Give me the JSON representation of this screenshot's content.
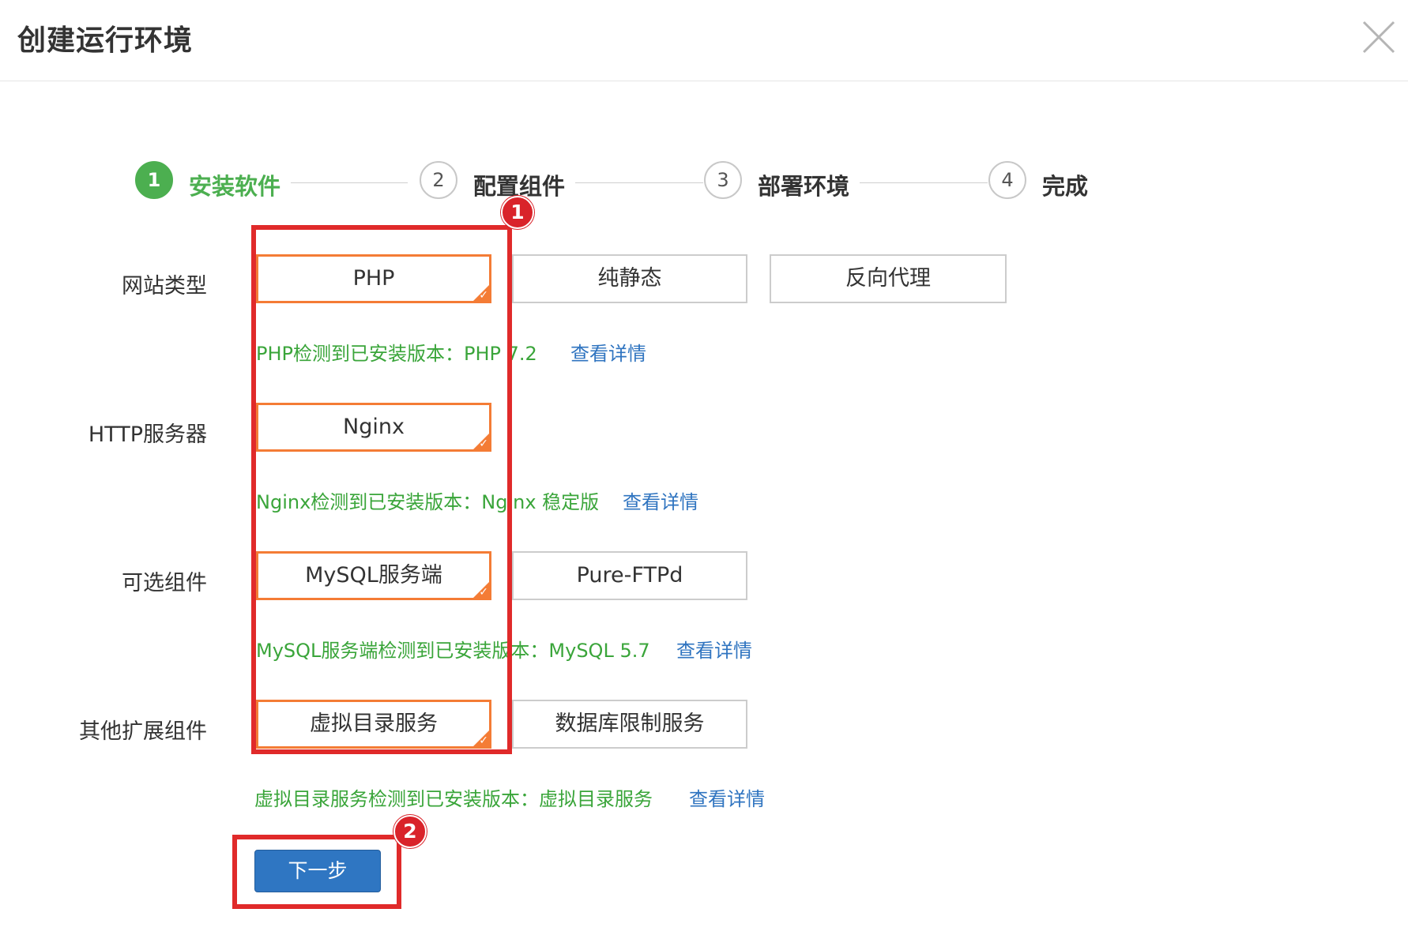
{
  "dialog": {
    "title": "创建运行环境"
  },
  "steps": [
    {
      "number": "1",
      "label": "安装软件",
      "active": true
    },
    {
      "number": "2",
      "label": "配置组件",
      "active": false
    },
    {
      "number": "3",
      "label": "部署环境",
      "active": false
    },
    {
      "number": "4",
      "label": "完成",
      "active": false
    }
  ],
  "rows": {
    "site_type": {
      "label": "网站类型",
      "options": [
        "PHP",
        "纯静态",
        "反向代理"
      ],
      "selected": "PHP",
      "info": "PHP检测到已安装版本：PHP 7.2",
      "link": "查看详情"
    },
    "http_server": {
      "label": "HTTP服务器",
      "options": [
        "Nginx"
      ],
      "selected": "Nginx",
      "info": "Nginx检测到已安装版本：Nginx 稳定版",
      "link": "查看详情"
    },
    "optional": {
      "label": "可选组件",
      "options": [
        "MySQL服务端",
        "Pure-FTPd"
      ],
      "selected": "MySQL服务端",
      "info": "MySQL服务端检测到已安装版本：MySQL 5.7",
      "link": "查看详情"
    },
    "extensions": {
      "label": "其他扩展组件",
      "options": [
        "虚拟目录服务",
        "数据库限制服务"
      ],
      "selected": "虚拟目录服务",
      "info": "虚拟目录服务检测到已安装版本：虚拟目录服务",
      "link": "查看详情"
    }
  },
  "next_button": "下一步",
  "annotations": [
    {
      "number": "1"
    },
    {
      "number": "2"
    }
  ],
  "colors": {
    "accent_green": "#4caf50",
    "selected_orange": "#f47c35",
    "info_green": "#3aa53a",
    "link_blue": "#2f74c0",
    "button_blue": "#2f76c2",
    "annotation_red": "#e02a2a"
  }
}
